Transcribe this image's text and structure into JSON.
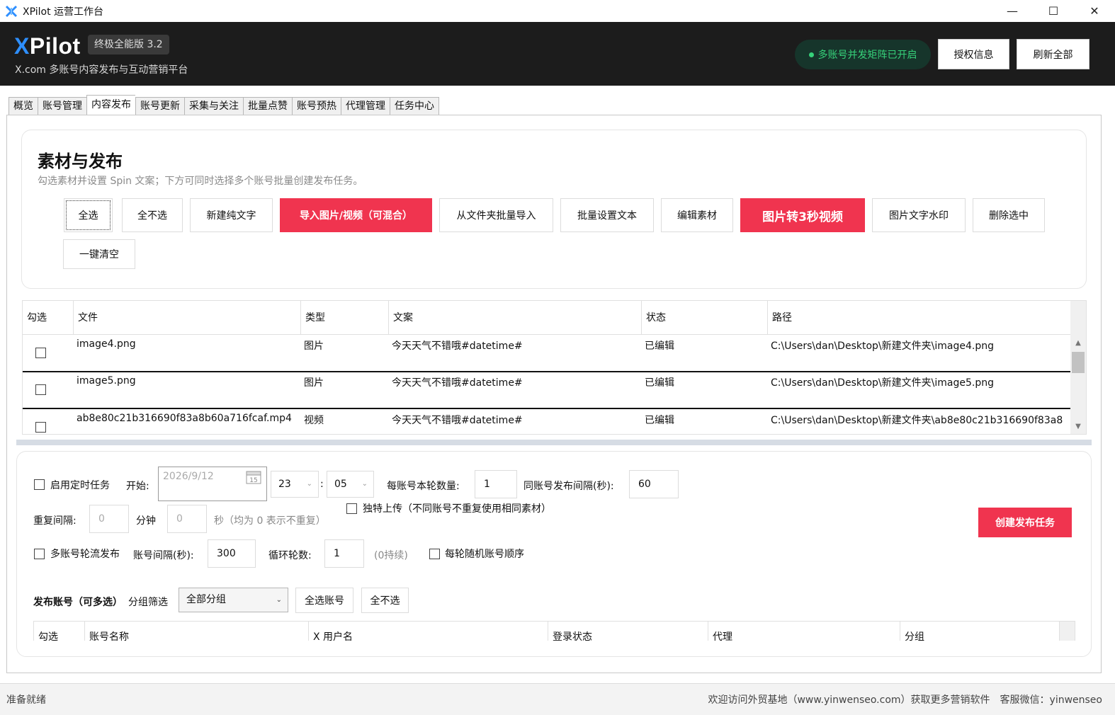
{
  "window": {
    "title": "XPilot 运营工作台",
    "minimize": "—",
    "maximize": "☐",
    "close": "✕"
  },
  "header": {
    "brand_x": "X",
    "brand_rest": "Pilot",
    "version": "终极全能版 3.2",
    "subtitle": "X.com 多账号内容发布与互动营销平台",
    "status": "多账号并发矩阵已开启",
    "license_btn": "授权信息",
    "refresh_btn": "刷新全部"
  },
  "tabs": [
    "概览",
    "账号管理",
    "内容发布",
    "账号更新",
    "采集与关注",
    "批量点赞",
    "账号预热",
    "代理管理",
    "任务中心"
  ],
  "material": {
    "title": "素材与发布",
    "desc": "勾选素材并设置 Spin 文案；下方可同时选择多个账号批量创建发布任务。",
    "buttons": {
      "select_all": "全选",
      "select_none": "全不选",
      "new_text": "新建纯文字",
      "import_media": "导入图片/视频（可混合）",
      "import_folder": "从文件夹批量导入",
      "batch_text": "批量设置文本",
      "edit": "编辑素材",
      "img_to_video": "图片转3秒视频",
      "watermark": "图片文字水印",
      "delete_selected": "删除选中",
      "clear_all": "一键清空"
    },
    "columns": [
      "勾选",
      "文件",
      "类型",
      "文案",
      "状态",
      "路径"
    ],
    "rows": [
      {
        "file": "image4.png",
        "type": "图片",
        "text": "今天天气不错哦#datetime#",
        "status": "已编辑",
        "path": "C:\\Users\\dan\\Desktop\\新建文件夹\\image4.png"
      },
      {
        "file": "image5.png",
        "type": "图片",
        "text": "今天天气不错哦#datetime#",
        "status": "已编辑",
        "path": "C:\\Users\\dan\\Desktop\\新建文件夹\\image5.png"
      },
      {
        "file": "ab8e80c21b316690f83a8b60a716fcaf.mp4",
        "type": "视频",
        "text": "今天天气不错哦#datetime#",
        "status": "已编辑",
        "path": "C:\\Users\\dan\\Desktop\\新建文件夹\\ab8e80c21b316690f83a8"
      }
    ]
  },
  "publish": {
    "schedule_label": "启用定时任务",
    "start_label": "开始:",
    "date_value": "2026/9/12",
    "hour": "23",
    "colon": ":",
    "minute": "05",
    "per_round_label": "每账号本轮数量:",
    "per_round_value": "1",
    "same_interval_label": "同账号发布间隔(秒):",
    "same_interval_value": "60",
    "unique_upload_label": "独特上传（不同账号不重复使用相同素材）",
    "repeat_label": "重复间隔:",
    "repeat_min_value": "0",
    "minute_unit": "分钟",
    "repeat_sec_value": "0",
    "second_note": "秒（均为 0 表示不重复）",
    "rotate_label": "多账号轮流发布",
    "acct_interval_label": "账号间隔(秒):",
    "acct_interval_value": "300",
    "loop_label": "循环轮数:",
    "loop_value": "1",
    "loop_note": "(0持续)",
    "random_order_label": "每轮随机账号顺序",
    "create_btn": "创建发布任务",
    "accounts_label": "发布账号（可多选）",
    "group_filter_label": "分组筛选",
    "group_value": "全部分组",
    "select_all_accounts": "全选账号",
    "select_none_accounts": "全不选",
    "columns": [
      "勾选",
      "账号名称",
      "X 用户名",
      "登录状态",
      "代理",
      "分组"
    ]
  },
  "statusbar": {
    "left": "准备就绪",
    "right": "欢迎访问外贸基地（www.yinwenseo.com）获取更多营销软件　客服微信：yinwenseo"
  },
  "colors": {
    "accent_red": "#f0344f",
    "header_bg": "#1c1c1c",
    "status_green": "#36d17a",
    "brand_blue": "#2e8fff"
  }
}
